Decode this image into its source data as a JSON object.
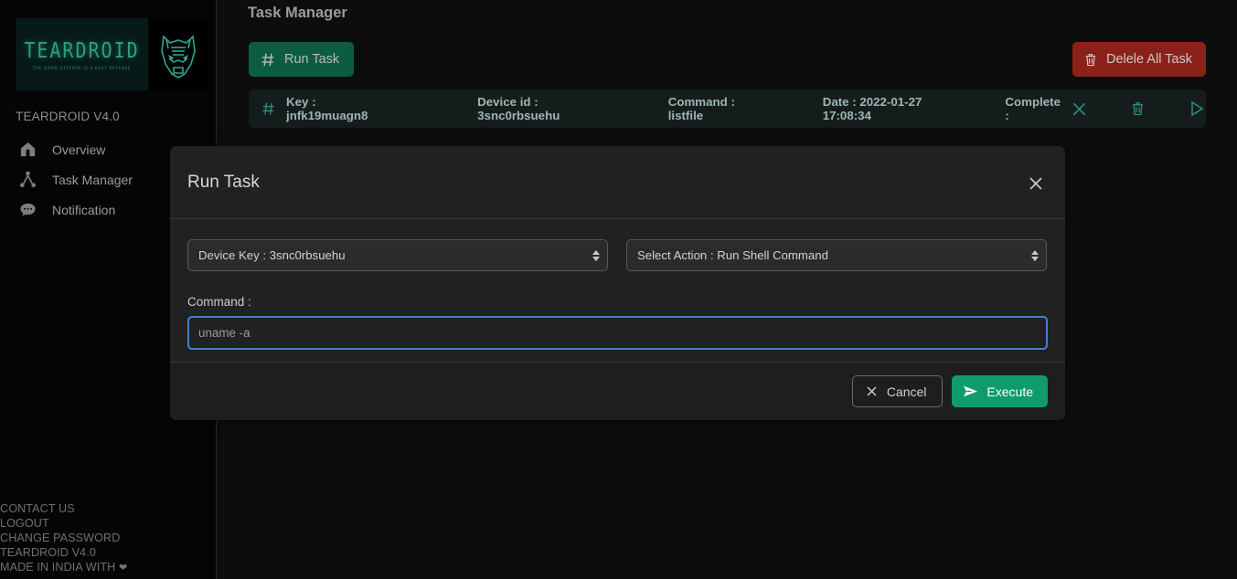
{
  "brand": {
    "logo_word": "TEARDROID",
    "logo_tagline": "THE GOOD OFFENSE IS A BEST DEFENSE",
    "logo_mark_icon": "wolf-head-icon",
    "version_label": "TEARDROID V4.0"
  },
  "sidebar": {
    "items": [
      {
        "label": "Overview",
        "icon": "home-icon"
      },
      {
        "label": "Task Manager",
        "icon": "sitemap-icon"
      },
      {
        "label": "Notification",
        "icon": "comment-icon"
      }
    ],
    "footer_links": [
      {
        "label": "CONTACT US"
      },
      {
        "label": "LOGOUT"
      },
      {
        "label": "CHANGE PASSWORD"
      },
      {
        "label": "TEARDROID V4.0"
      },
      {
        "label": "MADE IN INDIA WITH",
        "heart": "❤"
      }
    ]
  },
  "main": {
    "page_title": "Task Manager",
    "run_task_button": {
      "label": "Run Task",
      "icon": "hash-icon"
    },
    "delete_all_button": {
      "label": "Delele All Task",
      "icon": "trash-icon"
    },
    "task_row": {
      "hash_icon": "hash-icon",
      "key_label": "Key : jnfk19muagn8",
      "device_label": "Device id : 3snc0rbsuehu",
      "command_label": "Command : listfile",
      "date_label": "Date : 2022-01-27 17:08:34",
      "complete_label": "Complete :",
      "complete_state_icon": "x-icon",
      "delete_icon": "trash-icon",
      "run_icon": "play-icon"
    }
  },
  "modal": {
    "title": "Run Task",
    "close_icon": "close-icon",
    "device_key_select": {
      "value": "Device Key : 3snc0rbsuehu",
      "options": [
        "Device Key : 3snc0rbsuehu"
      ]
    },
    "action_select": {
      "value": "Select Action : Run Shell Command",
      "options": [
        "Select Action : Run Shell Command"
      ]
    },
    "command_label": "Command :",
    "command_input": {
      "value": "",
      "placeholder": "uname -a"
    },
    "cancel_button": {
      "label": "Cancel",
      "icon": "x-icon"
    },
    "execute_button": {
      "label": "Execute",
      "icon": "send-icon"
    }
  },
  "colors": {
    "accent_teal": "#2f8d80",
    "brand_green": "#0b5c43",
    "execute_green": "#0f9b6c",
    "danger_red": "#8b2118",
    "focus_blue": "#4a90e2",
    "modal_bg": "#212121",
    "page_bg": "#0d0d0d"
  }
}
